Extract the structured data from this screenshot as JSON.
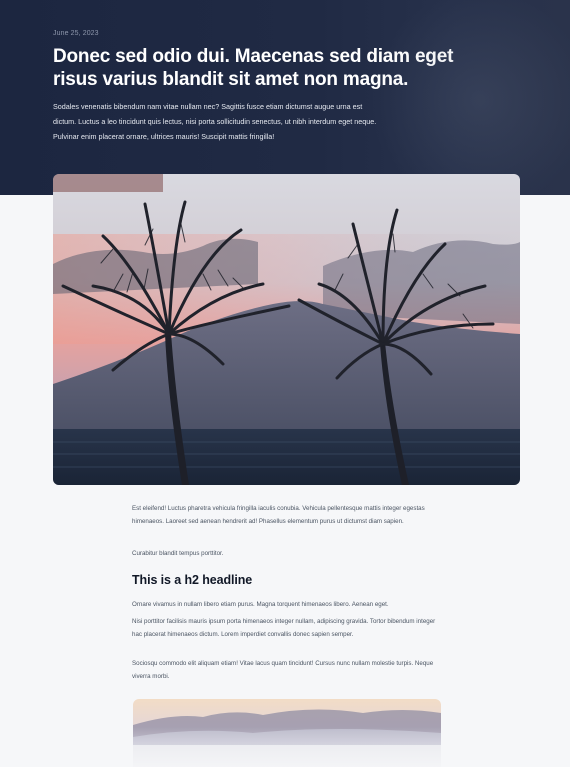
{
  "post": {
    "date": "June 25, 2023",
    "title": "Donec sed odio dui. Maecenas sed diam eget risus varius blandit sit amet non magna.",
    "lead": "Sodales venenatis bibendum nam vitae nullam nec? Sagittis fusce etiam dictumst augue urna est dictum. Luctus a leo tincidunt quis lectus, nisi porta sollicitudin senectus, ut nibh interdum eget neque. Pulvinar enim placerat ornare, ultrices mauris! Suscipit mattis fringilla!"
  },
  "body": {
    "p1": "Est eleifend! Luctus pharetra vehicula fringilla iaculis conubia. Vehicula pellentesque mattis integer egestas himenaeos. Laoreet sed aenean hendrerit ad! Phasellus elementum purus ut dictumst diam sapien.",
    "p2": "Curabitur blandit tempus porttitor.",
    "h2": "This is a h2 headline",
    "p3": "Ornare vivamus in nullam libero etiam purus. Magna torquent himenaeos libero. Aenean eget.",
    "p4": "Nisi porttitor facilisis mauris ipsum porta himenaeos integer nullam, adipiscing gravida. Tortor bibendum integer hac placerat himenaeos dictum. Lorem imperdiet convallis donec sapien semper.",
    "p5": "Sociosqu commodo elit aliquam etiam! Vitae lacus quam tincidunt! Cursus nunc nullam molestie turpis. Neque viverra morbi."
  },
  "images": {
    "hero_photo": "palm-trees-sunset-photo",
    "second_photo": "misty-mountain-photo"
  },
  "colors": {
    "hero_bg": "#1f2942",
    "page_bg": "#f6f7f9",
    "title": "#ffffff",
    "heading": "#111827",
    "body_text": "#4b5563"
  }
}
